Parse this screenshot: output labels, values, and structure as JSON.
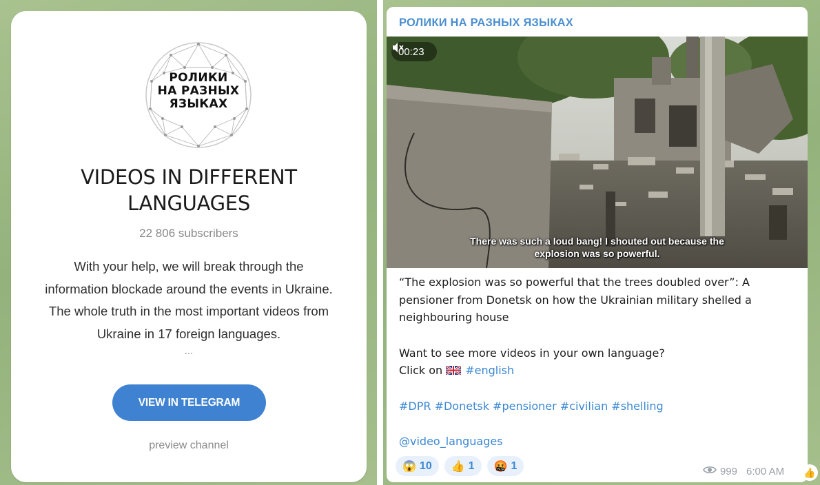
{
  "left_card": {
    "logo_lines": [
      "РОЛИКИ",
      "НА РАЗНЫХ",
      "ЯЗЫКАХ"
    ],
    "title_line1": "VIDEOS IN DIFFERENT",
    "title_line2": "LANGUAGES",
    "subscribers": "22 806 subscribers",
    "description": [
      "With your help, we will break through the",
      "information blockade around the events in Ukraine.",
      "The whole truth in the most important videos from",
      "Ukraine in 17 foreign languages."
    ],
    "ellipsis": "...",
    "view_button": "VIEW IN TELEGRAM",
    "preview_link": "preview channel"
  },
  "message": {
    "channel_name": "РОЛИКИ НА РАЗНЫХ ЯЗЫКАХ",
    "video": {
      "duration": "00:23",
      "subtitle_line1": "There was such a loud bang! I shouted out because the",
      "subtitle_line2": "explosion was so powerful."
    },
    "caption": {
      "line1": "“The explosion was so powerful that the trees doubled over”: A",
      "line2": "pensioner from Donetsk on how the Ukrainian military shelled a",
      "line3": "neighbouring house",
      "prompt": "Want to see more videos in your own language?",
      "click_on": "Click on ",
      "english_tag": "#english",
      "hashtags": "#DPR #Donetsk #pensioner #civilian #shelling",
      "handle": "@video_languages"
    },
    "reactions": [
      {
        "emoji": "😱",
        "count": "10"
      },
      {
        "emoji": "👍",
        "count": "1"
      },
      {
        "emoji": "🤬",
        "count": "1"
      }
    ],
    "views": "999",
    "time": "6:00 AM"
  },
  "colors": {
    "accent": "#3f82d1",
    "link": "#3b87d4",
    "channel_name": "#4b8fd0",
    "background_green": "#9db886"
  },
  "icons": [
    "mute-icon",
    "eye-icon",
    "uk-flag-icon",
    "thumbs-up-icon",
    "channel-logo-icon"
  ]
}
